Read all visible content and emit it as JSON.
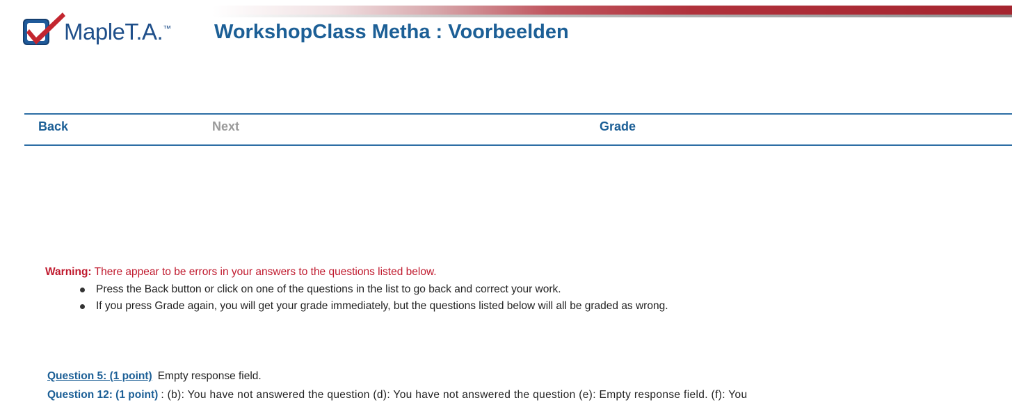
{
  "header": {
    "logo_text": "MapleT.A.",
    "logo_tm": "™",
    "title": "WorkshopClass Metha : Voorbeelden"
  },
  "nav": {
    "back": "Back",
    "next": "Next",
    "grade": "Grade"
  },
  "warning": {
    "label": "Warning:",
    "message": " There appear to be errors in your answers to the questions listed below.",
    "bullets": [
      "Press the Back button or click on one of the questions in the list to go back and correct your work.",
      "If you press Grade again, you will get your grade immediately, but the questions listed below will all be graded as wrong."
    ]
  },
  "questions": [
    {
      "link": "Question 5: (1 point)",
      "message": "Empty response field."
    },
    {
      "link": "Question 12: (1 point)",
      "message": ": (b): You have not answered the question (d): You have not answered the question (e): Empty response field. (f): You"
    }
  ],
  "colors": {
    "accent_blue": "#1c5f96",
    "warning_red": "#c01a2e",
    "disabled_gray": "#9a9a9a"
  }
}
